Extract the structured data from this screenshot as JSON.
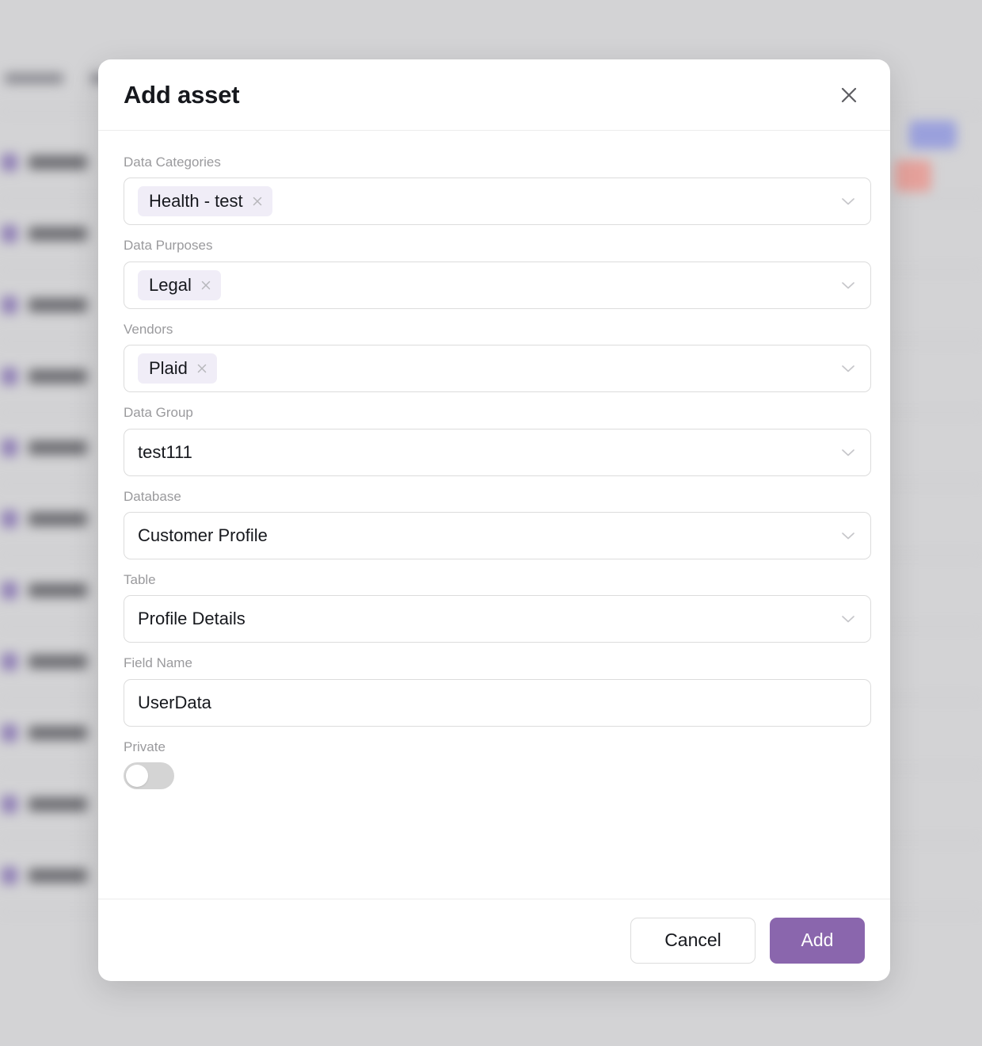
{
  "background": {
    "topbar_items": [
      "",
      "",
      "",
      ""
    ],
    "rows": [
      1,
      2,
      3,
      4,
      5,
      6,
      7,
      8,
      9,
      10,
      11
    ],
    "badges": [
      "blue-badge",
      "red-badge"
    ]
  },
  "modal": {
    "title": "Add asset",
    "close_icon": "close-icon",
    "fields": [
      {
        "label": "Data Categories",
        "type": "multiselect",
        "name": "data-categories",
        "chips": [
          {
            "label": "Health - test",
            "remove_icon": "close-small-icon"
          }
        ],
        "chevron_icon": "chevron-down-icon"
      },
      {
        "label": "Data Purposes",
        "type": "multiselect",
        "name": "data-purposes",
        "chips": [
          {
            "label": "Legal",
            "remove_icon": "close-small-icon"
          }
        ],
        "chevron_icon": "chevron-down-icon"
      },
      {
        "label": "Vendors",
        "type": "multiselect",
        "name": "vendors",
        "chips": [
          {
            "label": "Plaid",
            "remove_icon": "close-small-icon"
          }
        ],
        "chevron_icon": "chevron-down-icon"
      },
      {
        "label": "Data Group",
        "type": "select",
        "name": "data-group",
        "value": "test111",
        "chevron_icon": "chevron-down-icon"
      },
      {
        "label": "Database",
        "type": "select",
        "name": "database",
        "value": "Customer Profile",
        "chevron_icon": "chevron-down-icon"
      },
      {
        "label": "Table",
        "type": "select",
        "name": "table",
        "value": "Profile Details",
        "chevron_icon": "chevron-down-icon"
      },
      {
        "label": "Field Name",
        "type": "text",
        "name": "field-name",
        "value": "UserData"
      },
      {
        "label": "Private",
        "type": "toggle",
        "name": "private",
        "value": "off"
      }
    ],
    "footer": {
      "cancel_label": "Cancel",
      "add_label": "Add"
    }
  },
  "colors": {
    "accent": "#8a66ad",
    "chip_bg": "#f0edf7",
    "label": "#9a9a9d",
    "text": "#16181d",
    "border": "#dcdcdc",
    "overlay": "#d3d3d5",
    "toggle_track": "#d4d4d4"
  }
}
